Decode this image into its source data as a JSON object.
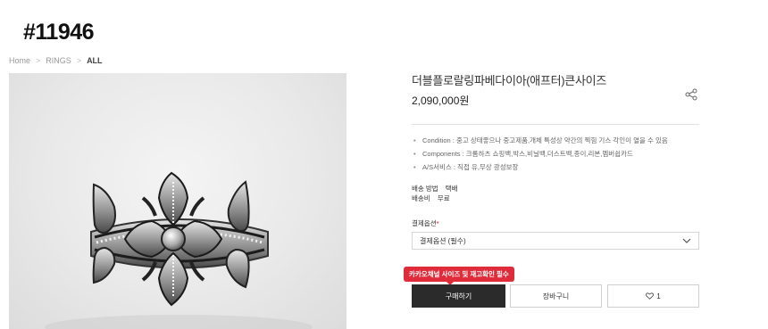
{
  "product_code": "#11946",
  "breadcrumb": {
    "home": "Home",
    "category": "RINGS",
    "current": "ALL",
    "separator": ">"
  },
  "product": {
    "title": "더블플로랄링파베다이아(애프터)큰사이즈",
    "price": "2,090,000원",
    "specs": [
      "Condition : 중고 상태좋으나 중고제품,개체 특성상 약간의 찍힘 기스 각인이 열을 수 있음",
      "Components : 크롬하츠 쇼핑백,박스,비닐백,더스트백,종이,리본,멤버쉽카드",
      "A/S서비스 : 직접 유,무상 광성보장"
    ],
    "shipping": [
      {
        "label": "배송 방법",
        "value": "택배"
      },
      {
        "label": "배송비",
        "value": "무료"
      }
    ]
  },
  "option": {
    "label": "결제옵션",
    "required_mark": "*",
    "selected": "결제옵션 (필수)"
  },
  "tooltip": "카카오채널 사이즈 및 재고확인 필수",
  "buttons": {
    "buy": "구매하기",
    "cart": "장바구니",
    "like_count": "1"
  },
  "icons": {
    "share": "share-icon",
    "like": "heart-icon",
    "select": "chevron-down-icon"
  },
  "colors": {
    "buy_button": "#2b2b2b",
    "tooltip": "#e02b3a",
    "required": "#d0021b"
  }
}
